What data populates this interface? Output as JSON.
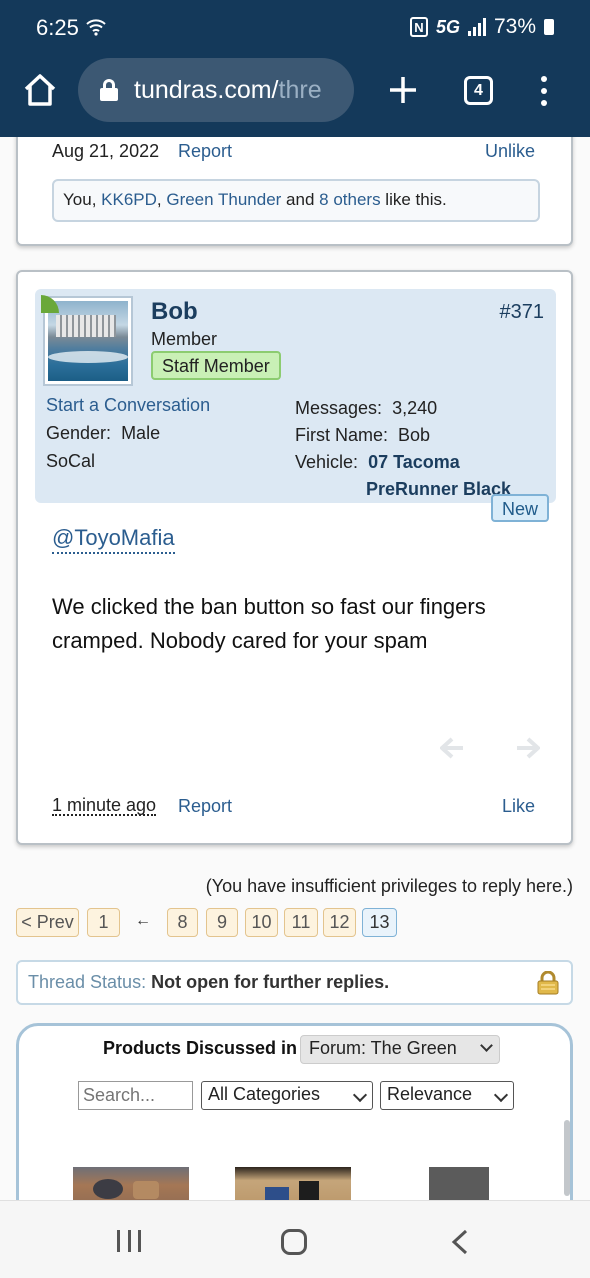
{
  "status_bar": {
    "time": "6:25",
    "nfc": "N",
    "network": "5G",
    "battery": "73%"
  },
  "browser": {
    "url_main": "tundras.com/",
    "url_rest": "thre",
    "tab_count": "4"
  },
  "prev_post": {
    "date": "Aug 21, 2022",
    "report": "Report",
    "unlike": "Unlike",
    "likes": {
      "prefix": "You, ",
      "user1": "KK6PD",
      "sep": ", ",
      "user2": "Green Thunder",
      "and": " and ",
      "others": "8 others",
      "suffix": " like this."
    }
  },
  "post": {
    "username": "Bob",
    "user_title": "Member",
    "staff_badge": "Staff Member",
    "number": "#371",
    "start_conversation": "Start a Conversation",
    "gender_label": "Gender:",
    "gender_value": "Male",
    "location": "SoCal",
    "messages_label": "Messages:",
    "messages_value": "3,240",
    "first_name_label": "First Name:",
    "first_name_value": "Bob",
    "vehicle_label": "Vehicle:",
    "vehicle_line1": "07 Tacoma",
    "vehicle_line2": "PreRunner Black",
    "new_badge": "New",
    "mention": "@ToyoMafia",
    "body": "We clicked the ban button so fast our fingers cramped. Nobody cared for your spam",
    "time": "1 minute ago",
    "report": "Report",
    "like": "Like"
  },
  "privileges_note": "(You have insufficient privileges to reply here.)",
  "pagination": {
    "prev": "< Prev",
    "pages": [
      "1",
      "8",
      "9",
      "10",
      "11",
      "12",
      "13"
    ],
    "current": "13",
    "ellipsis": "←"
  },
  "thread_status": {
    "label": "Thread Status:",
    "value": "Not open for further replies."
  },
  "products": {
    "heading": "Products Discussed in",
    "forum_select": "Forum: The Green",
    "search_placeholder": "Search...",
    "category_select": "All Categories",
    "sort_select": "Relevance"
  },
  "colors": {
    "header_bg": "#14395a",
    "link": "#2b5d8f",
    "user_panel_bg": "#dce8f3",
    "staff_badge_bg": "#c9f0b6"
  }
}
